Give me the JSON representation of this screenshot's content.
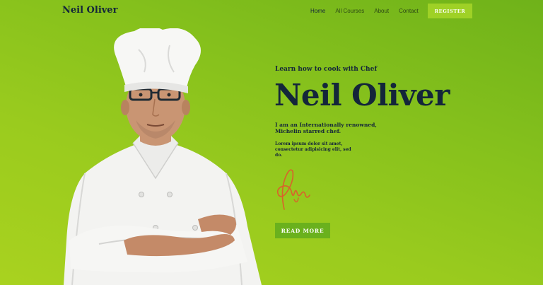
{
  "header": {
    "logo": "Neil Oliver",
    "nav": [
      {
        "label": "Home",
        "active": true
      },
      {
        "label": "All Courses"
      },
      {
        "label": "About"
      },
      {
        "label": "Contact"
      }
    ],
    "register_label": "REGISTER"
  },
  "hero": {
    "subtitle": "Learn how to cook with Chef",
    "title": "Neil Oliver",
    "tagline": "I am an Internationally renowned, Michelin starred chef.",
    "lorem": "Lorem ipsum dolor sit amet, consectetur adipisicing elit, sed do.",
    "read_more_label": "READ MORE"
  },
  "colors": {
    "background": "#86c11c",
    "text_dark": "#14263a",
    "register_button": "#9fd126",
    "read_more_button": "#6ab11d",
    "signature": "#d9622b"
  }
}
